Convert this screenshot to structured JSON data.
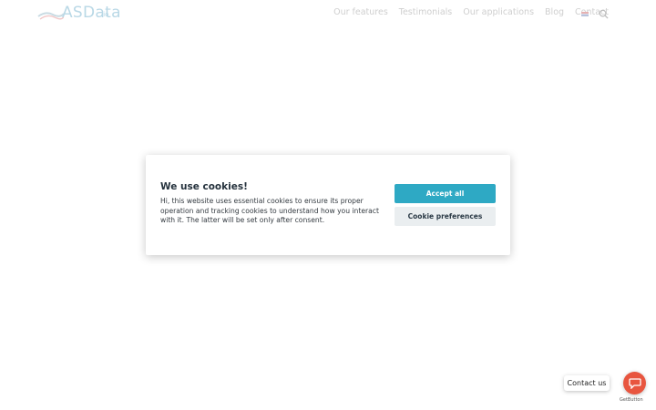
{
  "header": {
    "logo": {
      "word": "ASData",
      "suffix": ".io"
    },
    "nav": [
      {
        "label": "Our features"
      },
      {
        "label": "Testimonials"
      },
      {
        "label": "Our applications"
      },
      {
        "label": "Blog"
      },
      {
        "label": "Contact"
      }
    ],
    "language_flag": "uk-flag-icon",
    "search_icon": "search-icon"
  },
  "cookie_modal": {
    "title": "We use cookies!",
    "text": "Hi, this website uses essential cookies to ensure its proper operation and tracking cookies to understand how you interact with it. The latter will be set only after consent.",
    "accept_label": "Accept all",
    "preferences_label": "Cookie preferences",
    "accent_color": "#2ea9c4"
  },
  "contact_widget": {
    "label": "Contact us",
    "button_color": "#e8553f",
    "icon": "chat-bubble-icon",
    "credit": "GetButton"
  }
}
